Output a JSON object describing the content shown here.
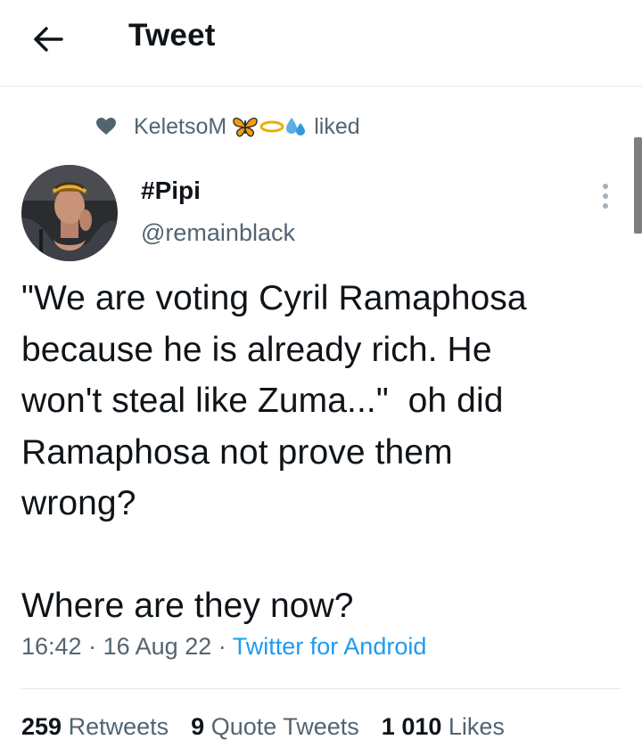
{
  "header": {
    "title": "Tweet",
    "back_icon": "arrow-left-icon"
  },
  "social_context": {
    "icon": "heart-icon",
    "user": "KeletsoM",
    "emojis": [
      "butterfly-emoji-icon",
      "halo-emoji-icon",
      "sweat-droplets-emoji-icon"
    ],
    "action": "liked"
  },
  "tweet": {
    "display_name": "#Pipi",
    "handle": "@remainblack",
    "lines": [
      "\"We are voting Cyril Ramaphosa",
      "because he is already rich. He",
      "won't steal like Zuma...\"  oh did",
      "Ramaphosa not prove them",
      "wrong?",
      "Where are they now?"
    ],
    "time": "16:42",
    "date": "16 Aug 22",
    "separator": "·",
    "source": "Twitter for Android"
  },
  "stats": {
    "retweets_count": "259",
    "retweets_label": "Retweets",
    "quotes_count": "9",
    "quotes_label": "Quote Tweets",
    "likes_count": "1 010",
    "likes_label": "Likes"
  },
  "colors": {
    "accent": "#1d9bf0",
    "text": "#0f1419",
    "secondary": "#536471",
    "divider": "#e6e9eb"
  }
}
